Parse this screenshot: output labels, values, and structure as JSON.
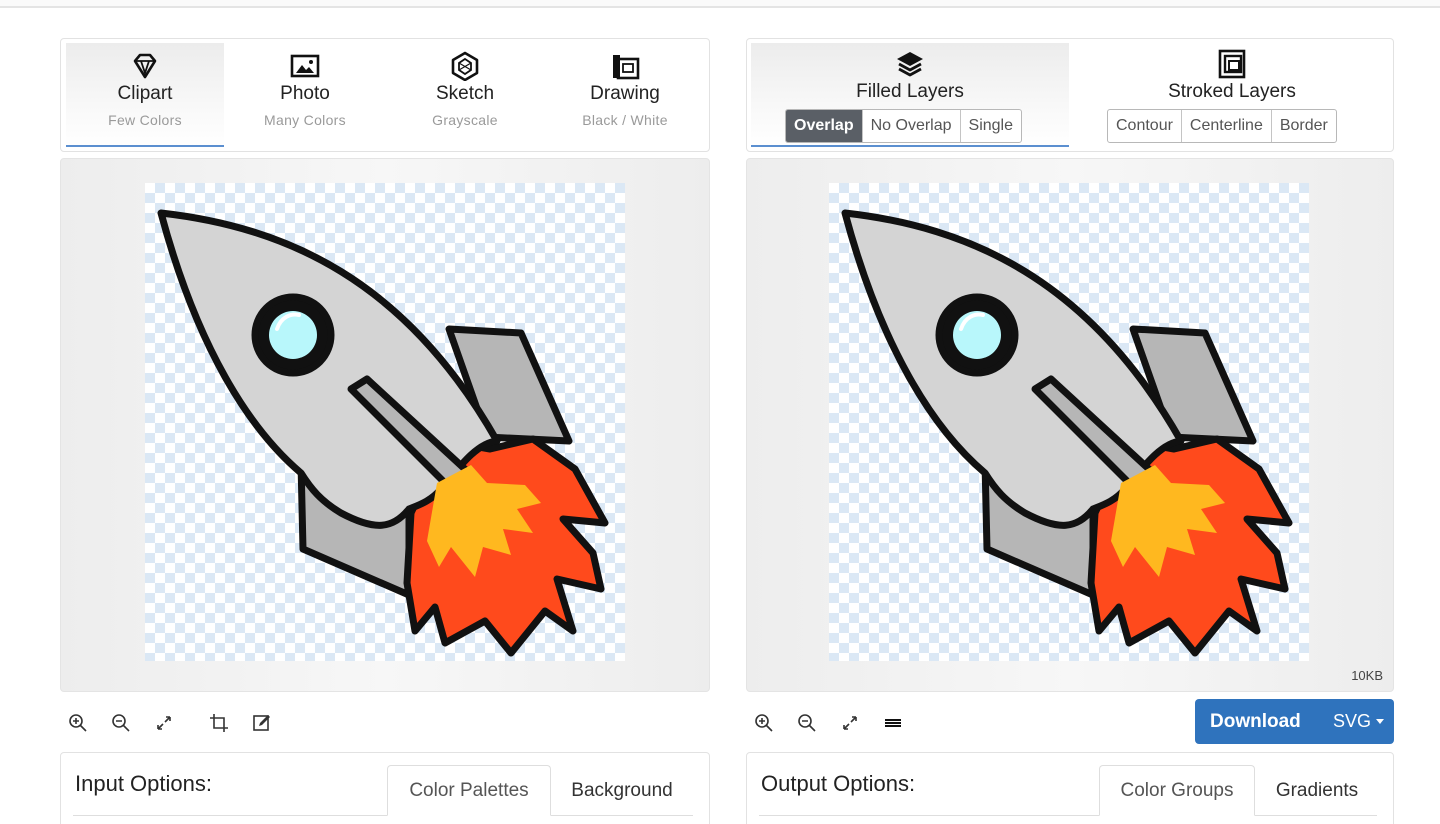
{
  "classify_modes": [
    {
      "icon": "diamond-icon",
      "title": "Clipart",
      "subtitle": "Few Colors",
      "active": true
    },
    {
      "icon": "image-icon",
      "title": "Photo",
      "subtitle": "Many Colors",
      "active": false
    },
    {
      "icon": "hexagon-icon",
      "title": "Sketch",
      "subtitle": "Grayscale",
      "active": false
    },
    {
      "icon": "sketchbook-icon",
      "title": "Drawing",
      "subtitle": "Black / White",
      "active": false
    }
  ],
  "output_modes": {
    "filled": {
      "icon": "layers-icon",
      "title": "Filled Layers",
      "options": [
        "Overlap",
        "No Overlap",
        "Single"
      ],
      "selected": "Overlap",
      "active": true
    },
    "stroked": {
      "icon": "stroked-squares-icon",
      "title": "Stroked Layers",
      "options": [
        "Contour",
        "Centerline",
        "Border"
      ]
    }
  },
  "result": {
    "file_size": "10KB"
  },
  "toolbar_left": [
    "zoom-in-icon",
    "zoom-out-icon",
    "fit-expand-icon",
    "crop-icon",
    "edit-icon"
  ],
  "toolbar_right": [
    "zoom-in-icon",
    "zoom-out-icon",
    "fit-expand-icon",
    "menu-lines-icon"
  ],
  "download": {
    "label": "Download",
    "format": "SVG"
  },
  "input_options": {
    "title": "Input Options:",
    "tabs": [
      "Color Palettes",
      "Background"
    ],
    "active_tab": "Color Palettes"
  },
  "output_options": {
    "title": "Output Options:",
    "tabs": [
      "Color Groups",
      "Gradients"
    ],
    "active_tab": "Color Groups"
  },
  "colors": {
    "accent": "#2f73bd",
    "tab_underline": "#5b8fd0",
    "segment_active": "#5a5f66",
    "flame_outer": "#ff4a1c",
    "flame_inner": "#ffb81f",
    "rocket_body": "#d4d4d4",
    "window": "#b8f7fb"
  }
}
